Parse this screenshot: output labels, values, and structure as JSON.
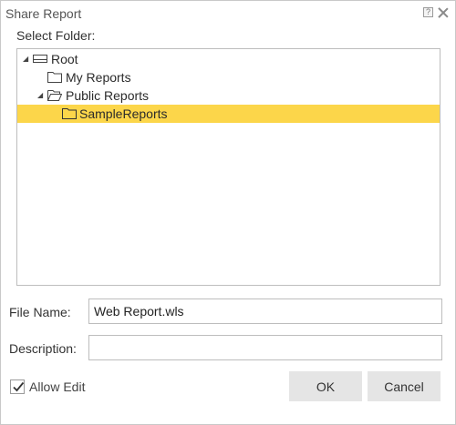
{
  "dialog": {
    "title": "Share Report",
    "help_glyph": "?"
  },
  "tree": {
    "label": "Select Folder:",
    "nodes": [
      {
        "label": "Root",
        "icon": "drive-icon",
        "expanded": true
      },
      {
        "label": "My Reports",
        "icon": "folder-icon"
      },
      {
        "label": "Public Reports",
        "icon": "folder-open-icon",
        "expanded": true
      },
      {
        "label": "SampleReports",
        "icon": "folder-icon",
        "selected": true
      }
    ],
    "selected_color": "#fcd64a"
  },
  "form": {
    "file_name_label": "File Name:",
    "file_name_value": "Web Report.wls",
    "description_label": "Description:",
    "description_value": "",
    "allow_edit_label": "Allow Edit",
    "allow_edit_checked": true
  },
  "buttons": {
    "ok": "OK",
    "cancel": "Cancel"
  }
}
